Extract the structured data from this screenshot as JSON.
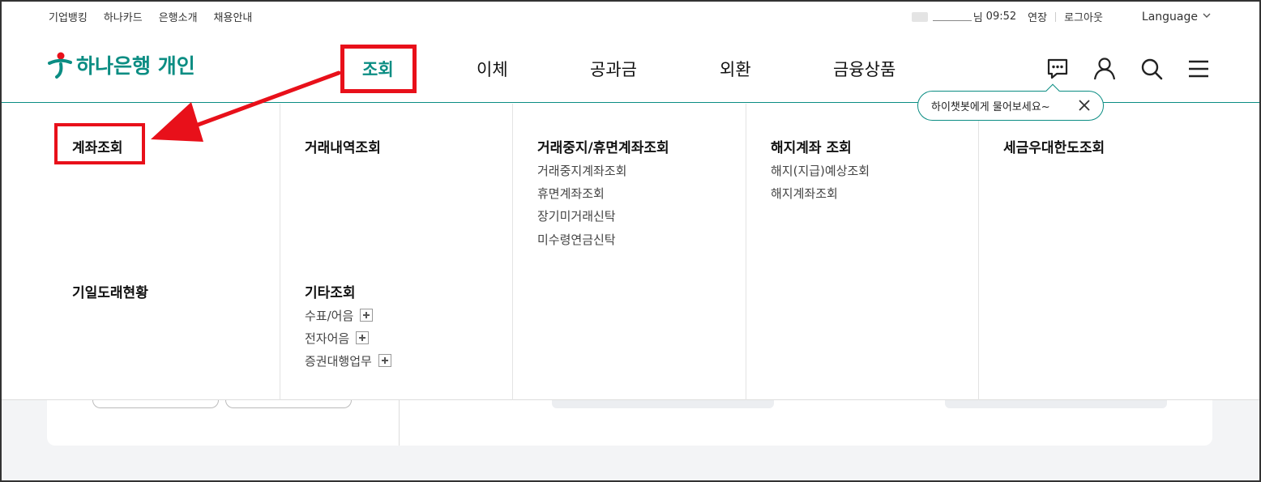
{
  "utility": {
    "links": [
      "기업뱅킹",
      "하나카드",
      "은행소개",
      "채용안내"
    ],
    "user_suffix": "님",
    "session_time": "09:52",
    "extend": "연장",
    "logout": "로그아웃",
    "language": "Language"
  },
  "header": {
    "logo_text": "하나은행 개인",
    "nav": [
      "조회",
      "이체",
      "공과금",
      "외환",
      "금융상품"
    ],
    "active_nav": "조회"
  },
  "chatbot_tip": {
    "text": "하이챗봇에게 물어보세요~"
  },
  "mega_menu": {
    "columns": [
      {
        "head": "계좌조회",
        "subs": []
      },
      {
        "head": "거래내역조회",
        "subs": []
      },
      {
        "head": "거래중지/휴면계좌조회",
        "subs": [
          "거래중지계좌조회",
          "휴면계좌조회",
          "장기미거래신탁",
          "미수령연금신탁"
        ]
      },
      {
        "head": "해지계좌 조회",
        "subs": [
          "해지(지급)예상조회",
          "해지계좌조회"
        ]
      },
      {
        "head": "세금우대한도조회",
        "subs": []
      }
    ],
    "row2": [
      {
        "head": "기일도래현황",
        "subs": []
      },
      {
        "head": "기타조회",
        "subs": [
          "수표/어음",
          "전자어음",
          "증권대행업무"
        ]
      }
    ]
  },
  "colors": {
    "brand": "#0b8d83",
    "highlight": "#e8101a"
  }
}
